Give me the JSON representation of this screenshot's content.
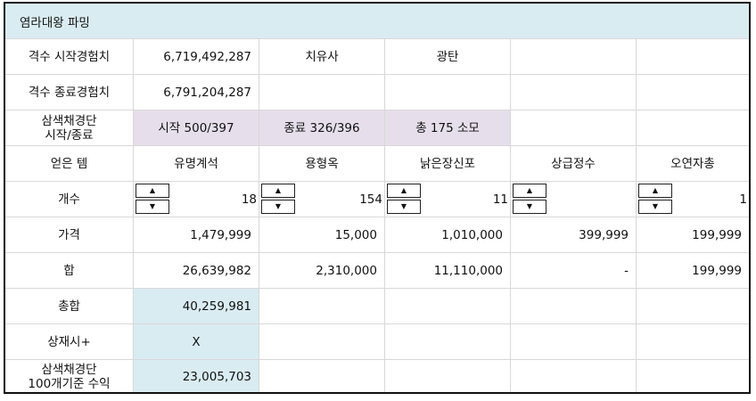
{
  "title": "염라대왕 파밍",
  "rows": {
    "start_exp": {
      "label": "격수 시작경험치",
      "value": "6,719,492,287",
      "col3": "치유사",
      "col4": "광탄"
    },
    "end_exp": {
      "label": "격수 종료경험치",
      "value": "6,791,204,287"
    },
    "dust": {
      "label_line1": "삼색채경단",
      "label_line2": "시작/종료",
      "start": "시작 500/397",
      "end": "종료 326/396",
      "total": "총 175 소모"
    },
    "items": {
      "label": "얻은 템",
      "names": [
        "유명계석",
        "용형옥",
        "낡은장신포",
        "상급정수",
        "오연자총"
      ]
    },
    "count": {
      "label": "개수",
      "values": [
        "18",
        "154",
        "11",
        "",
        "1"
      ],
      "up_glyph": "▲",
      "down_glyph": "▼"
    },
    "price": {
      "label": "가격",
      "values": [
        "1,479,999",
        "15,000",
        "1,010,000",
        "399,999",
        "199,999"
      ]
    },
    "sum": {
      "label": "합",
      "values": [
        "26,639,982",
        "2,310,000",
        "11,110,000",
        "-",
        "199,999"
      ]
    },
    "total": {
      "label": "총합",
      "value": "40,259,981"
    },
    "sell": {
      "label": "상재시+",
      "value": "X"
    },
    "profit": {
      "label_line1": "삼색채경단",
      "label_line2": "100개기준 수익",
      "value": "23,005,703"
    }
  },
  "colors": {
    "title_bg": "#d9ecf2",
    "lavender": "#e6dfeb",
    "highlight": "#d9ecf2",
    "grid": "#d8d8d8"
  }
}
